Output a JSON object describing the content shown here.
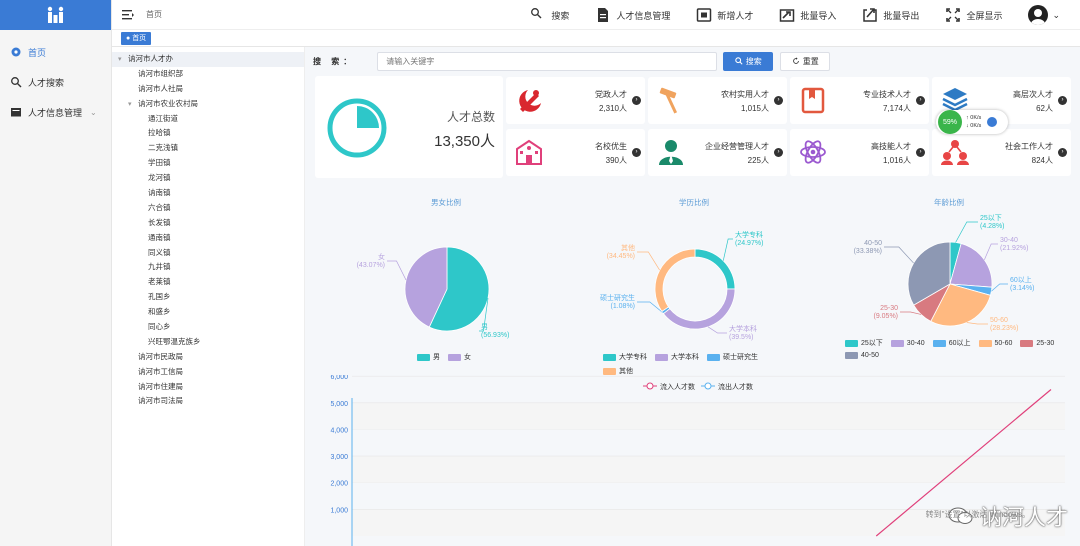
{
  "sidebar": {
    "items": [
      {
        "label": "首页",
        "icon": "dashboard-icon",
        "active": true
      },
      {
        "label": "人才搜索",
        "icon": "search-icon"
      },
      {
        "label": "人才信息管理",
        "icon": "folder-icon",
        "chevron": "⌄"
      }
    ]
  },
  "header": {
    "breadcrumb": "首页",
    "actions": [
      {
        "label": "搜索",
        "icon": "search-icon"
      },
      {
        "label": "人才信息管理",
        "icon": "document-icon"
      },
      {
        "label": "新增人才",
        "icon": "add-icon"
      },
      {
        "label": "批量导入",
        "icon": "import-icon"
      },
      {
        "label": "批量导出",
        "icon": "export-icon"
      },
      {
        "label": "全屏显示",
        "icon": "fullscreen-icon"
      }
    ],
    "avatar_dropdown": "⌄"
  },
  "tagbar": {
    "tag_label": "首页"
  },
  "tree": {
    "nodes": [
      {
        "label": "讷河市人才办",
        "level": 0,
        "expanded": true,
        "selected": true
      },
      {
        "label": "讷河市组织部",
        "level": 1
      },
      {
        "label": "讷河市人社局",
        "level": 1
      },
      {
        "label": "讷河市农业农村局",
        "level": 1,
        "expanded": true
      },
      {
        "label": "通江街道",
        "level": 2
      },
      {
        "label": "拉哈镇",
        "level": 2
      },
      {
        "label": "二克浅镇",
        "level": 2
      },
      {
        "label": "学田镇",
        "level": 2
      },
      {
        "label": "龙河镇",
        "level": 2
      },
      {
        "label": "讷南镇",
        "level": 2
      },
      {
        "label": "六合镇",
        "level": 2
      },
      {
        "label": "长发镇",
        "level": 2
      },
      {
        "label": "通南镇",
        "level": 2
      },
      {
        "label": "同义镇",
        "level": 2
      },
      {
        "label": "九井镇",
        "level": 2
      },
      {
        "label": "老莱镇",
        "level": 2
      },
      {
        "label": "孔国乡",
        "level": 2
      },
      {
        "label": "和盛乡",
        "level": 2
      },
      {
        "label": "同心乡",
        "level": 2
      },
      {
        "label": "兴旺鄂温克族乡",
        "level": 2
      },
      {
        "label": "讷河市民政局",
        "level": 1
      },
      {
        "label": "讷河市工信局",
        "level": 1
      },
      {
        "label": "讷河市住建局",
        "level": 1
      },
      {
        "label": "讷河市司法局",
        "level": 1
      }
    ]
  },
  "search": {
    "label": "搜 索：",
    "placeholder": "请输入关键字",
    "search_button": "搜索",
    "reset_button": "重置"
  },
  "total": {
    "label": "人才总数",
    "value": "13,350人",
    "fill_fraction": 0.25
  },
  "stats": [
    {
      "name": "党政人才",
      "value": "2,310人",
      "icon": "party-emblem-icon",
      "color": "#d9272e"
    },
    {
      "name": "农村实用人才",
      "value": "1,015人",
      "icon": "hammer-icon",
      "color": "#f0a35e"
    },
    {
      "name": "专业技术人才",
      "value": "7,174人",
      "icon": "book-icon",
      "color": "#e2583e"
    },
    {
      "name": "高层次人才",
      "value": "62人",
      "icon": "layers-icon",
      "color": "#2e7bc4"
    },
    {
      "name": "名校优生",
      "value": "390人",
      "icon": "school-building-icon",
      "color": "#e0407b"
    },
    {
      "name": "企业经营管理人才",
      "value": "225人",
      "icon": "manager-icon",
      "color": "#1a8a6a"
    },
    {
      "name": "高技能人才",
      "value": "1,016人",
      "icon": "atom-icon",
      "color": "#9b59d0"
    },
    {
      "name": "社会工作人才",
      "value": "824人",
      "icon": "team-icon",
      "color": "#e84545"
    }
  ],
  "speed_widget": {
    "percent": "59%",
    "up": "0K/s",
    "down": "0K/s"
  },
  "chart_data": [
    {
      "type": "pie",
      "title": "男女比例",
      "slices": [
        {
          "name": "男",
          "value": 56.93,
          "label": "男",
          "pct": "(56.93%)",
          "color": "#2ec7c9"
        },
        {
          "name": "女",
          "value": 43.07,
          "label": "女",
          "pct": "(43.07%)",
          "color": "#b6a2de"
        }
      ]
    },
    {
      "type": "pie",
      "title": "学历比例",
      "donut": true,
      "slices": [
        {
          "name": "大学专科",
          "value": 24.97,
          "label": "大学专科",
          "pct": "(24.97%)",
          "color": "#2ec7c9"
        },
        {
          "name": "大学本科",
          "value": 39.5,
          "label": "大学本科",
          "pct": "(39.5%)",
          "color": "#b6a2de"
        },
        {
          "name": "硕士研究生",
          "value": 1.08,
          "label": "硕士研究生",
          "pct": "(1.08%)",
          "color": "#5ab1ef"
        },
        {
          "name": "其他",
          "value": 34.45,
          "label": "其他",
          "pct": "(34.45%)",
          "color": "#ffb980"
        }
      ]
    },
    {
      "type": "pie",
      "title": "年龄比例",
      "slices": [
        {
          "name": "25以下",
          "value": 4.28,
          "label": "25以下",
          "pct": "(4.28%)",
          "color": "#2ec7c9"
        },
        {
          "name": "30-40",
          "value": 21.92,
          "label": "30-40",
          "pct": "(21.92%)",
          "color": "#b6a2de"
        },
        {
          "name": "60以上",
          "value": 3.14,
          "label": "60以上",
          "pct": "(3.14%)",
          "color": "#5ab1ef"
        },
        {
          "name": "50-60",
          "value": 28.23,
          "label": "50-60",
          "pct": "(28.23%)",
          "color": "#ffb980"
        },
        {
          "name": "25-30",
          "value": 9.05,
          "label": "25-30",
          "pct": "(9.05%)",
          "color": "#d87a80"
        },
        {
          "name": "40-50",
          "value": 33.38,
          "label": "40-50",
          "pct": "(33.38%)",
          "color": "#8d98b3"
        }
      ]
    },
    {
      "type": "line",
      "series": [
        {
          "name": "流入人才数",
          "color": "#e0407b"
        },
        {
          "name": "流出人才数",
          "color": "#5ab1ef"
        }
      ],
      "yticks": [
        "1,000",
        "2,000",
        "3,000",
        "4,000",
        "5,000",
        "6,000"
      ],
      "ylim": [
        0,
        6000
      ],
      "inflow_points_visible": [
        {
          "x": 0.75,
          "y": 0
        },
        {
          "x": 1.0,
          "y": 5500
        }
      ]
    }
  ],
  "watermark": {
    "text": "讷河人才",
    "activate": "转到\"设置\"以激活 Windows。"
  }
}
